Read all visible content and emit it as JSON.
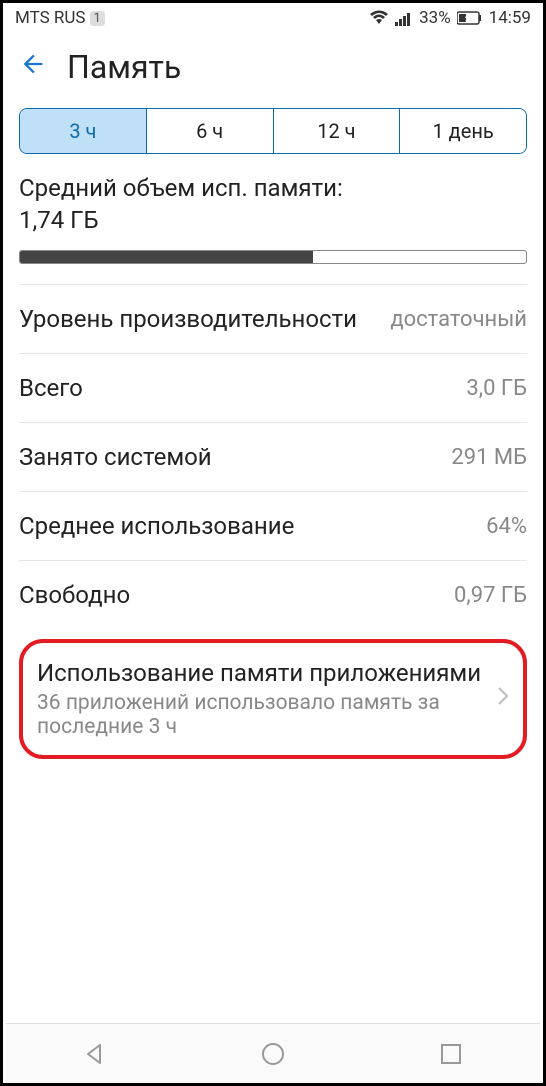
{
  "statusBar": {
    "carrier": "MTS RUS",
    "simNumber": "1",
    "batteryPercent": "33%",
    "time": "14:59"
  },
  "header": {
    "title": "Память"
  },
  "segments": {
    "s1": "3 ч",
    "s2": "6 ч",
    "s3": "12 ч",
    "s4": "1 день"
  },
  "avgMemory": {
    "label": "Средний объем исп. памяти:",
    "value": "1,74 ГБ"
  },
  "rows": {
    "performance": {
      "label": "Уровень производительности",
      "value": "достаточный"
    },
    "total": {
      "label": "Всего",
      "value": "3,0 ГБ"
    },
    "system": {
      "label": "Занято системой",
      "value": "291 МБ"
    },
    "avgUse": {
      "label": "Среднее использование",
      "value": "64%"
    },
    "free": {
      "label": "Свободно",
      "value": "0,97 ГБ"
    }
  },
  "appUsage": {
    "title": "Использование памяти приложениями",
    "subtitle": "36 приложений использовало память за последние 3 ч"
  }
}
